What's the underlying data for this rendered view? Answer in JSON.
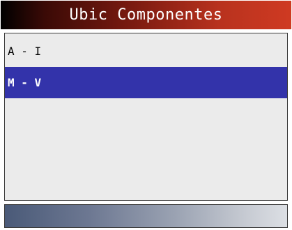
{
  "title": "Ubic Componentes",
  "menu": {
    "items": [
      {
        "label": "A - I",
        "selected": false
      },
      {
        "label": "M - V",
        "selected": true
      }
    ],
    "selected_color": "#3333aa"
  },
  "colors": {
    "title_gradient_end": "#cf3a22",
    "list_background": "#ebebeb",
    "status_gradient_start": "#4a5a78"
  }
}
